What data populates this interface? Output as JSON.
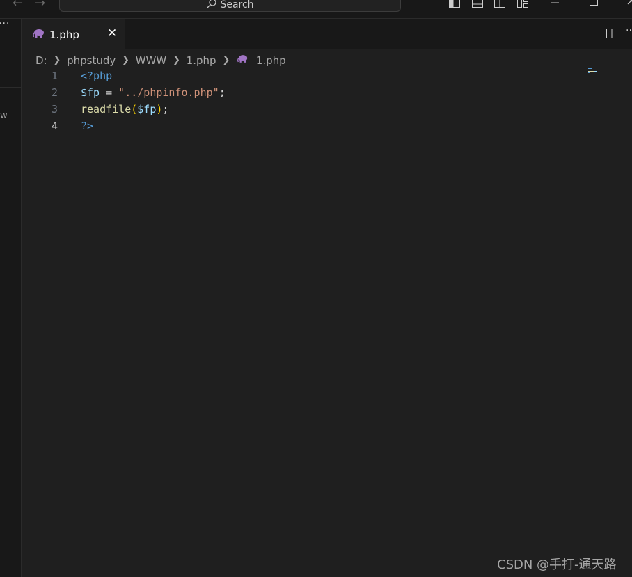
{
  "titlebar": {
    "back_icon": "arrow-left-icon",
    "forward_icon": "arrow-right-icon",
    "search_placeholder": "Search",
    "layout_icons": [
      "toggle-primary-sidebar-icon",
      "toggle-panel-icon",
      "toggle-secondary-sidebar-icon",
      "customize-layout-icon"
    ],
    "window_controls": [
      "minimize-icon",
      "maximize-icon",
      "close-icon"
    ]
  },
  "sidebar": {
    "more_label": "···",
    "partial_text": "w"
  },
  "tabs": [
    {
      "label": "1.php",
      "icon": "php-elephant-icon",
      "active": true
    }
  ],
  "breadcrumb": {
    "items": [
      "D:",
      "phpstudy",
      "WWW",
      "1.php",
      "1.php"
    ]
  },
  "editor": {
    "lines": [
      {
        "number": "1",
        "tokens": [
          {
            "t": "<?php",
            "c": "tk-tag"
          }
        ]
      },
      {
        "number": "2",
        "tokens": [
          {
            "t": "$fp",
            "c": "tk-var"
          },
          {
            "t": " = ",
            "c": "tk-op"
          },
          {
            "t": "\"../phpinfo.php\"",
            "c": "tk-str"
          },
          {
            "t": ";",
            "c": "tk-punct"
          }
        ]
      },
      {
        "number": "3",
        "tokens": [
          {
            "t": "readfile",
            "c": "tk-fn"
          },
          {
            "t": "(",
            "c": "tk-paren"
          },
          {
            "t": "$fp",
            "c": "tk-var"
          },
          {
            "t": ")",
            "c": "tk-paren"
          },
          {
            "t": ";",
            "c": "tk-punct"
          }
        ]
      },
      {
        "number": "4",
        "tokens": [
          {
            "t": "?>",
            "c": "tk-tag"
          }
        ]
      }
    ],
    "current_line": "4"
  },
  "colors": {
    "background": "#1f1f1f",
    "accent": "#0078d4",
    "php_icon": "#a074c4"
  },
  "watermark": "CSDN @手打-通天路"
}
